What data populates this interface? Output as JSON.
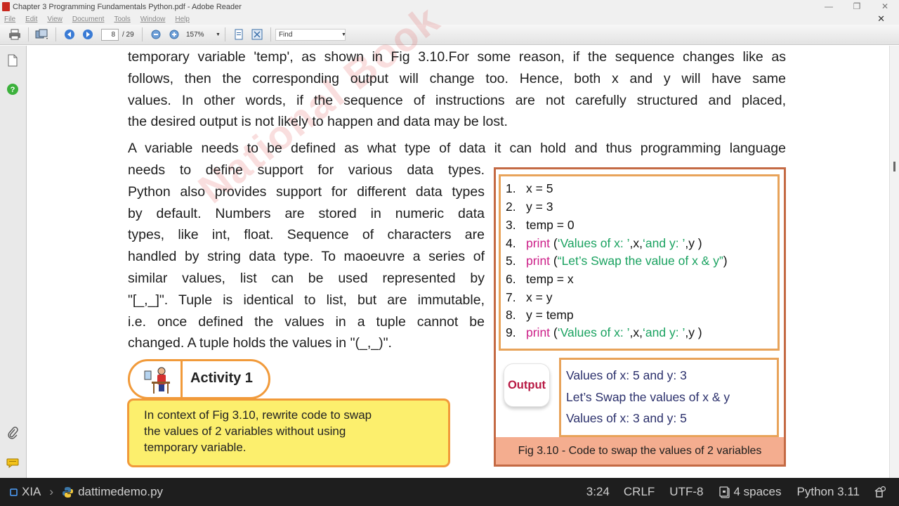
{
  "window": {
    "title": "Chapter 3 Programming Fundamentals Python.pdf - Adobe Reader"
  },
  "menu": [
    "File",
    "Edit",
    "View",
    "Document",
    "Tools",
    "Window",
    "Help"
  ],
  "toolbar": {
    "page_current": "8",
    "page_total": "/ 29",
    "zoom": "157%",
    "find_placeholder": "Find"
  },
  "document": {
    "para1": [
      "temporary variable 'temp', as shown in Fig 3.10.For some reason, if the sequence changes like as",
      "follows, then the corresponding output will change too. Hence, both x and y will have same",
      "values. In other words, if the sequence of instructions are not carefully structured and placed,",
      "the desired output is not likely to happen and data may be lost."
    ],
    "para2_first": "A variable needs to be defined as what type of data it can hold and thus programming language",
    "para2_rest": [
      "needs to define support for various data types.",
      "Python also provides support for different data types",
      "by default. Numbers are stored in numeric data",
      "types, like int, float. Sequence of characters are",
      "handled by string data type. To maoeuvre a series of",
      "similar values, list can be used represented by",
      "\"[_,_]\". Tuple is identical to list, but are immutable,",
      "i.e. once defined the values in a tuple cannot be",
      "changed. A tuple holds the values in \"(_,_)\"."
    ],
    "watermark": "National Book",
    "code": [
      {
        "num": "1.",
        "parts": [
          {
            "t": "x = 5",
            "c": ""
          }
        ]
      },
      {
        "num": "2.",
        "parts": [
          {
            "t": "y = 3",
            "c": ""
          }
        ]
      },
      {
        "num": "3.",
        "parts": [
          {
            "t": "temp = 0",
            "c": ""
          }
        ]
      },
      {
        "num": "4.",
        "parts": [
          {
            "t": "print",
            "c": "kw"
          },
          {
            "t": " (",
            "c": ""
          },
          {
            "t": "‘Values of x: ’",
            "c": "str"
          },
          {
            "t": ",x,",
            "c": ""
          },
          {
            "t": "‘and y: ’",
            "c": "str"
          },
          {
            "t": ",y )",
            "c": ""
          }
        ]
      },
      {
        "num": "5.",
        "parts": [
          {
            "t": "print",
            "c": "kw"
          },
          {
            "t": " (",
            "c": ""
          },
          {
            "t": "“Let’s Swap the value of x & y”",
            "c": "str"
          },
          {
            "t": ")",
            "c": ""
          }
        ]
      },
      {
        "num": "6.",
        "parts": [
          {
            "t": "temp = x",
            "c": ""
          }
        ]
      },
      {
        "num": "7.",
        "parts": [
          {
            "t": "x = y",
            "c": ""
          }
        ]
      },
      {
        "num": "8.",
        "parts": [
          {
            "t": "y = temp",
            "c": ""
          }
        ]
      },
      {
        "num": "9.",
        "parts": [
          {
            "t": "print",
            "c": "kw"
          },
          {
            "t": " (",
            "c": ""
          },
          {
            "t": "‘Values of x: ’",
            "c": "str"
          },
          {
            "t": ",x,",
            "c": ""
          },
          {
            "t": "‘and y: ’",
            "c": "str"
          },
          {
            "t": ",y )",
            "c": ""
          }
        ]
      }
    ],
    "output_label": "Output",
    "output_lines": [
      "Values of x: 5 and y: 3",
      "Let’s Swap the values of x & y",
      "Values of x: 3 and y: 5"
    ],
    "caption": "Fig 3.10 - Code to swap the values of 2 variables",
    "activity_title": "Activity 1",
    "activity_text": [
      "In context of Fig 3.10, rewrite code to swap",
      "the values of 2 variables without using",
      "temporary variable."
    ]
  },
  "statusbar": {
    "remote": "XIA",
    "file": "dattimedemo.py",
    "position": "3:24",
    "eol": "CRLF",
    "encoding": "UTF-8",
    "indent": "4 spaces",
    "language": "Python 3.11"
  },
  "colors": {
    "keyword": "#cc1f88",
    "string": "#1aa260",
    "fig_border": "#c46a44",
    "activity_border": "#f19a3a",
    "activity_fill": "#fcef6d"
  }
}
